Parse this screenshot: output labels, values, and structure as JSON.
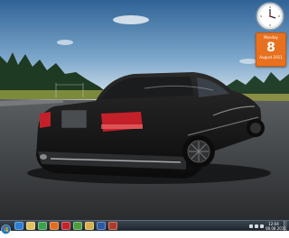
{
  "desktop": {
    "wallpaper": "black sedan on asphalt at dusk"
  },
  "gadgets": {
    "clock": {
      "icon": "analog-clock-icon"
    },
    "calendar": {
      "weekday": "Monday",
      "day": "8",
      "month_year": "August 2011"
    }
  },
  "taskbar": {
    "start_icon": "windows-start-orb",
    "pinned": [
      {
        "name": "internet-explorer-icon",
        "color": "#2a7fd4"
      },
      {
        "name": "windows-explorer-icon",
        "color": "#e2c15a"
      },
      {
        "name": "media-player-icon",
        "color": "#3aa34a"
      },
      {
        "name": "firefox-icon",
        "color": "#e06d1e"
      },
      {
        "name": "opera-icon",
        "color": "#c4232a"
      },
      {
        "name": "chrome-icon",
        "color": "#4b9e3a"
      },
      {
        "name": "folder-icon",
        "color": "#d8b04a"
      },
      {
        "name": "photoshop-icon",
        "color": "#2b5aa3"
      },
      {
        "name": "app-icon",
        "color": "#b03a2a"
      }
    ],
    "tray": {
      "time": "12:04",
      "date": "08.08.2011"
    }
  },
  "colors": {
    "sky_top": "#3b6fa5",
    "sky_bottom": "#b9d1e4",
    "asphalt": "#3a3d40",
    "calendar": "#e8711f"
  }
}
